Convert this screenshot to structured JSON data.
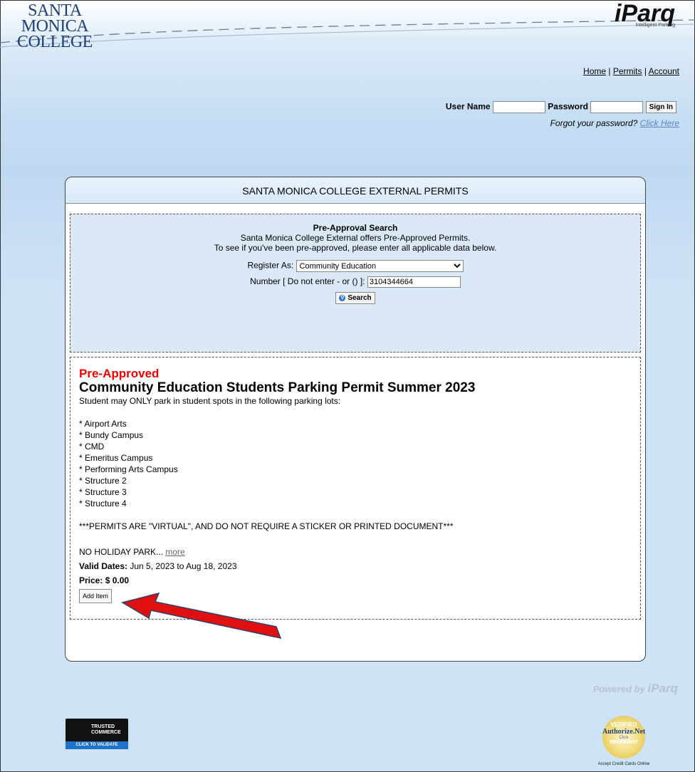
{
  "header": {
    "logo_left_lines": [
      "SANTA",
      "MONICA",
      "COLLEGE"
    ],
    "logo_right": "iParq",
    "logo_right_tagline": "Intelligent Parking"
  },
  "nav": {
    "home": "Home",
    "sep1": " | ",
    "permits": "Permits",
    "sep2": " | ",
    "account": "Account"
  },
  "login": {
    "username_label": "User Name",
    "username_value": "",
    "password_label": "Password",
    "password_value": "",
    "signin_label": "Sign In",
    "forgot_text": "Forgot your password? ",
    "forgot_link": "Click Here"
  },
  "panel": {
    "title": "SANTA MONICA COLLEGE EXTERNAL PERMITS"
  },
  "search": {
    "heading": "Pre-Approval Search",
    "line1": "Santa Monica College External offers Pre-Approved Permits.",
    "line2": "To see if you've been pre-approved, please enter all applicable data below.",
    "register_label": "Register As:",
    "register_value": "Community Education",
    "number_label": "Number [ Do not enter - or () ]:",
    "number_value": "3104344664",
    "search_button": "Search"
  },
  "result": {
    "status": "Pre-Approved",
    "title": "Community Education Students Parking Permit Summer 2023",
    "intro": "Student may ONLY park in student spots in the following parking lots:",
    "lots": [
      "* Airport Arts",
      "* Bundy Campus",
      "* CMD",
      "* Emeritus Campus",
      "* Performing Arts Campus",
      "* Structure 2",
      "* Structure 3",
      "* Structure 4"
    ],
    "notice": "***PERMITS ARE \"VIRTUAL\", AND DO NOT REQUIRE A STICKER OR PRINTED DOCUMENT***",
    "holiday_text": "NO HOLIDAY PARK... ",
    "more_link": "more",
    "valid_label": "Valid Dates:",
    "valid_value": " Jun 5, 2023 to Aug 18, 2023",
    "price_label": "Price:",
    "price_value": " $ 0.00",
    "add_button": "Add Item"
  },
  "footer": {
    "powered_by": "Powered by ",
    "powered_brand": "iParq",
    "trusted_line1": "TRUSTED",
    "trusted_line2": "COMMERCE",
    "trusted_validate": "CLICK TO VALIDATE",
    "seal_top": "VERIFIED",
    "seal_brand": "Authorize.Net",
    "seal_click": "Click",
    "seal_bottom": "MERCHANT",
    "seal_caption": "Accept Credit Cards Online"
  },
  "colors": {
    "pre_approved": "#ee0000",
    "arrow": "#e01010",
    "link_blue": "#5a84c8"
  }
}
